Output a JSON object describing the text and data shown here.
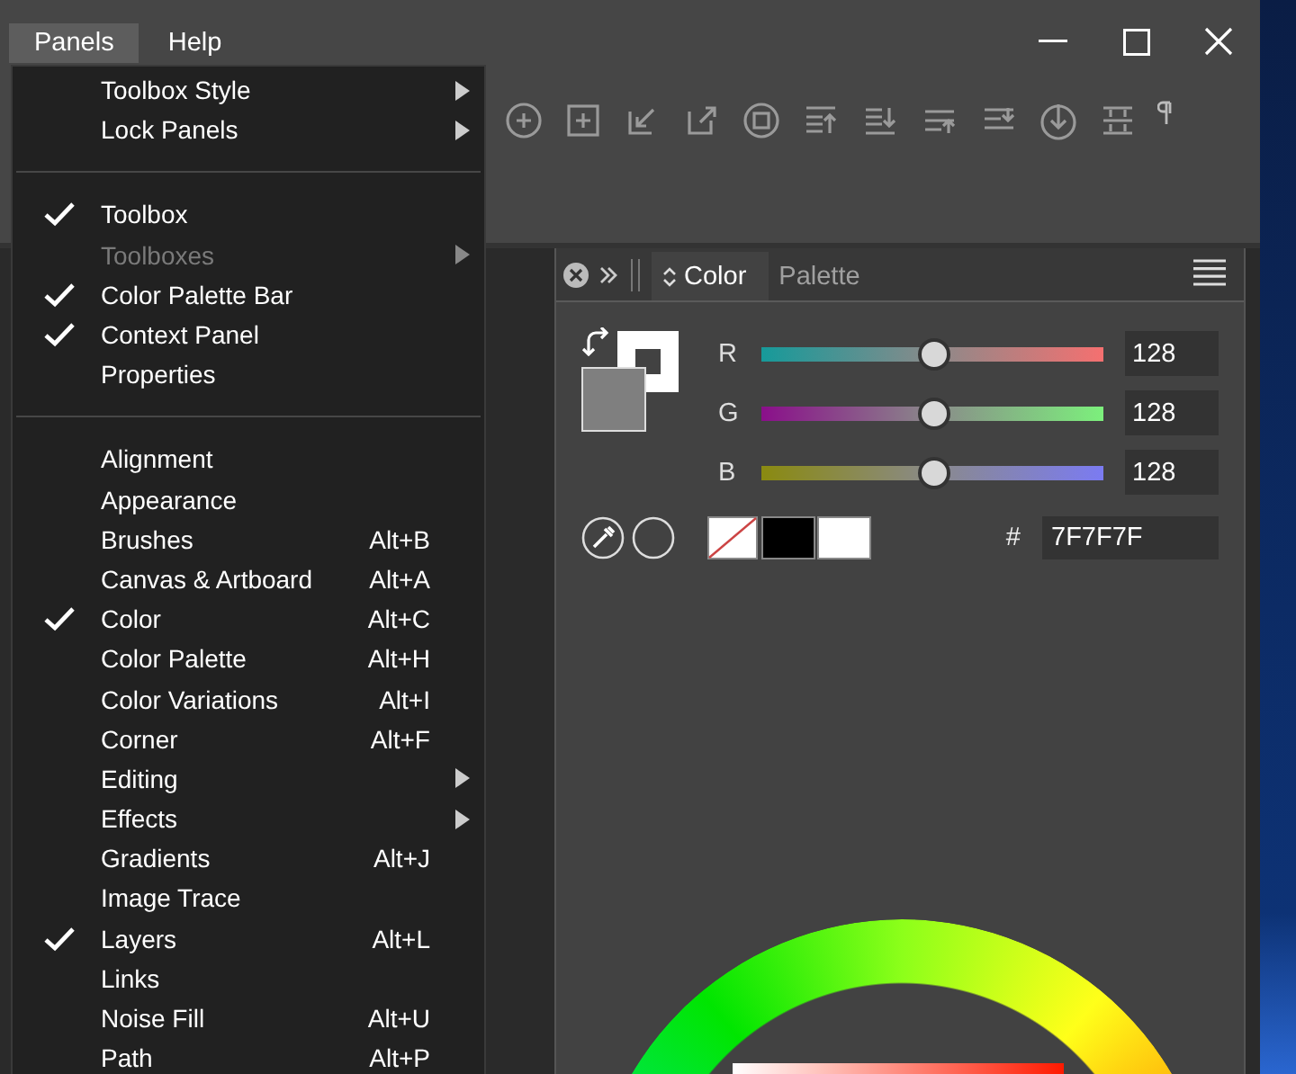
{
  "menubar": [
    {
      "label": "Panels",
      "selected": true
    },
    {
      "label": "Help",
      "selected": false
    }
  ],
  "menu": {
    "sections": [
      [
        {
          "label": "Toolbox Style",
          "checked": false,
          "disabled": false,
          "submenu": true
        },
        {
          "label": "Lock Panels",
          "checked": false,
          "disabled": false,
          "submenu": true
        }
      ],
      [
        {
          "label": "Toolbox",
          "checked": true,
          "disabled": false,
          "submenu": false
        },
        {
          "label": "Toolboxes",
          "checked": false,
          "disabled": true,
          "submenu": true
        },
        {
          "label": "Color Palette Bar",
          "checked": true,
          "disabled": false,
          "submenu": false
        },
        {
          "label": "Context Panel",
          "checked": true,
          "disabled": false,
          "submenu": false
        },
        {
          "label": "Properties",
          "checked": false,
          "disabled": false,
          "submenu": false
        }
      ],
      [
        {
          "label": "Alignment",
          "checked": false,
          "disabled": false,
          "submenu": false
        },
        {
          "label": "Appearance",
          "checked": false,
          "disabled": false,
          "submenu": false
        },
        {
          "label": "Brushes",
          "shortcut": "Alt+B",
          "checked": false,
          "disabled": false,
          "submenu": false
        },
        {
          "label": "Canvas & Artboard",
          "shortcut": "Alt+A",
          "checked": false,
          "disabled": false,
          "submenu": false
        },
        {
          "label": "Color",
          "shortcut": "Alt+C",
          "checked": true,
          "disabled": false,
          "submenu": false
        },
        {
          "label": "Color Palette",
          "shortcut": "Alt+H",
          "checked": false,
          "disabled": false,
          "submenu": false
        },
        {
          "label": "Color Variations",
          "shortcut": "Alt+I",
          "checked": false,
          "disabled": false,
          "submenu": false
        },
        {
          "label": "Corner",
          "shortcut": "Alt+F",
          "checked": false,
          "disabled": false,
          "submenu": false
        },
        {
          "label": "Editing",
          "checked": false,
          "disabled": false,
          "submenu": true
        },
        {
          "label": "Effects",
          "checked": false,
          "disabled": false,
          "submenu": true
        },
        {
          "label": "Gradients",
          "shortcut": "Alt+J",
          "checked": false,
          "disabled": false,
          "submenu": false
        },
        {
          "label": "Image Trace",
          "checked": false,
          "disabled": false,
          "submenu": false
        },
        {
          "label": "Layers",
          "shortcut": "Alt+L",
          "checked": true,
          "disabled": false,
          "submenu": false
        },
        {
          "label": "Links",
          "checked": false,
          "disabled": false,
          "submenu": false
        },
        {
          "label": "Noise Fill",
          "shortcut": "Alt+U",
          "checked": false,
          "disabled": false,
          "submenu": false
        },
        {
          "label": "Path",
          "shortcut": "Alt+P",
          "checked": false,
          "disabled": false,
          "submenu": false
        }
      ]
    ]
  },
  "panel": {
    "tabs": [
      {
        "label": "Color",
        "selected": true
      },
      {
        "label": "Palette",
        "selected": false
      }
    ],
    "channels": [
      {
        "name": "R",
        "level": 0.5,
        "reading": "128"
      },
      {
        "name": "G",
        "level": 0.5,
        "reading": "128"
      },
      {
        "name": "B",
        "level": 0.5,
        "reading": "128"
      }
    ],
    "hex_label": "#",
    "hex_value": "7F7F7F"
  }
}
